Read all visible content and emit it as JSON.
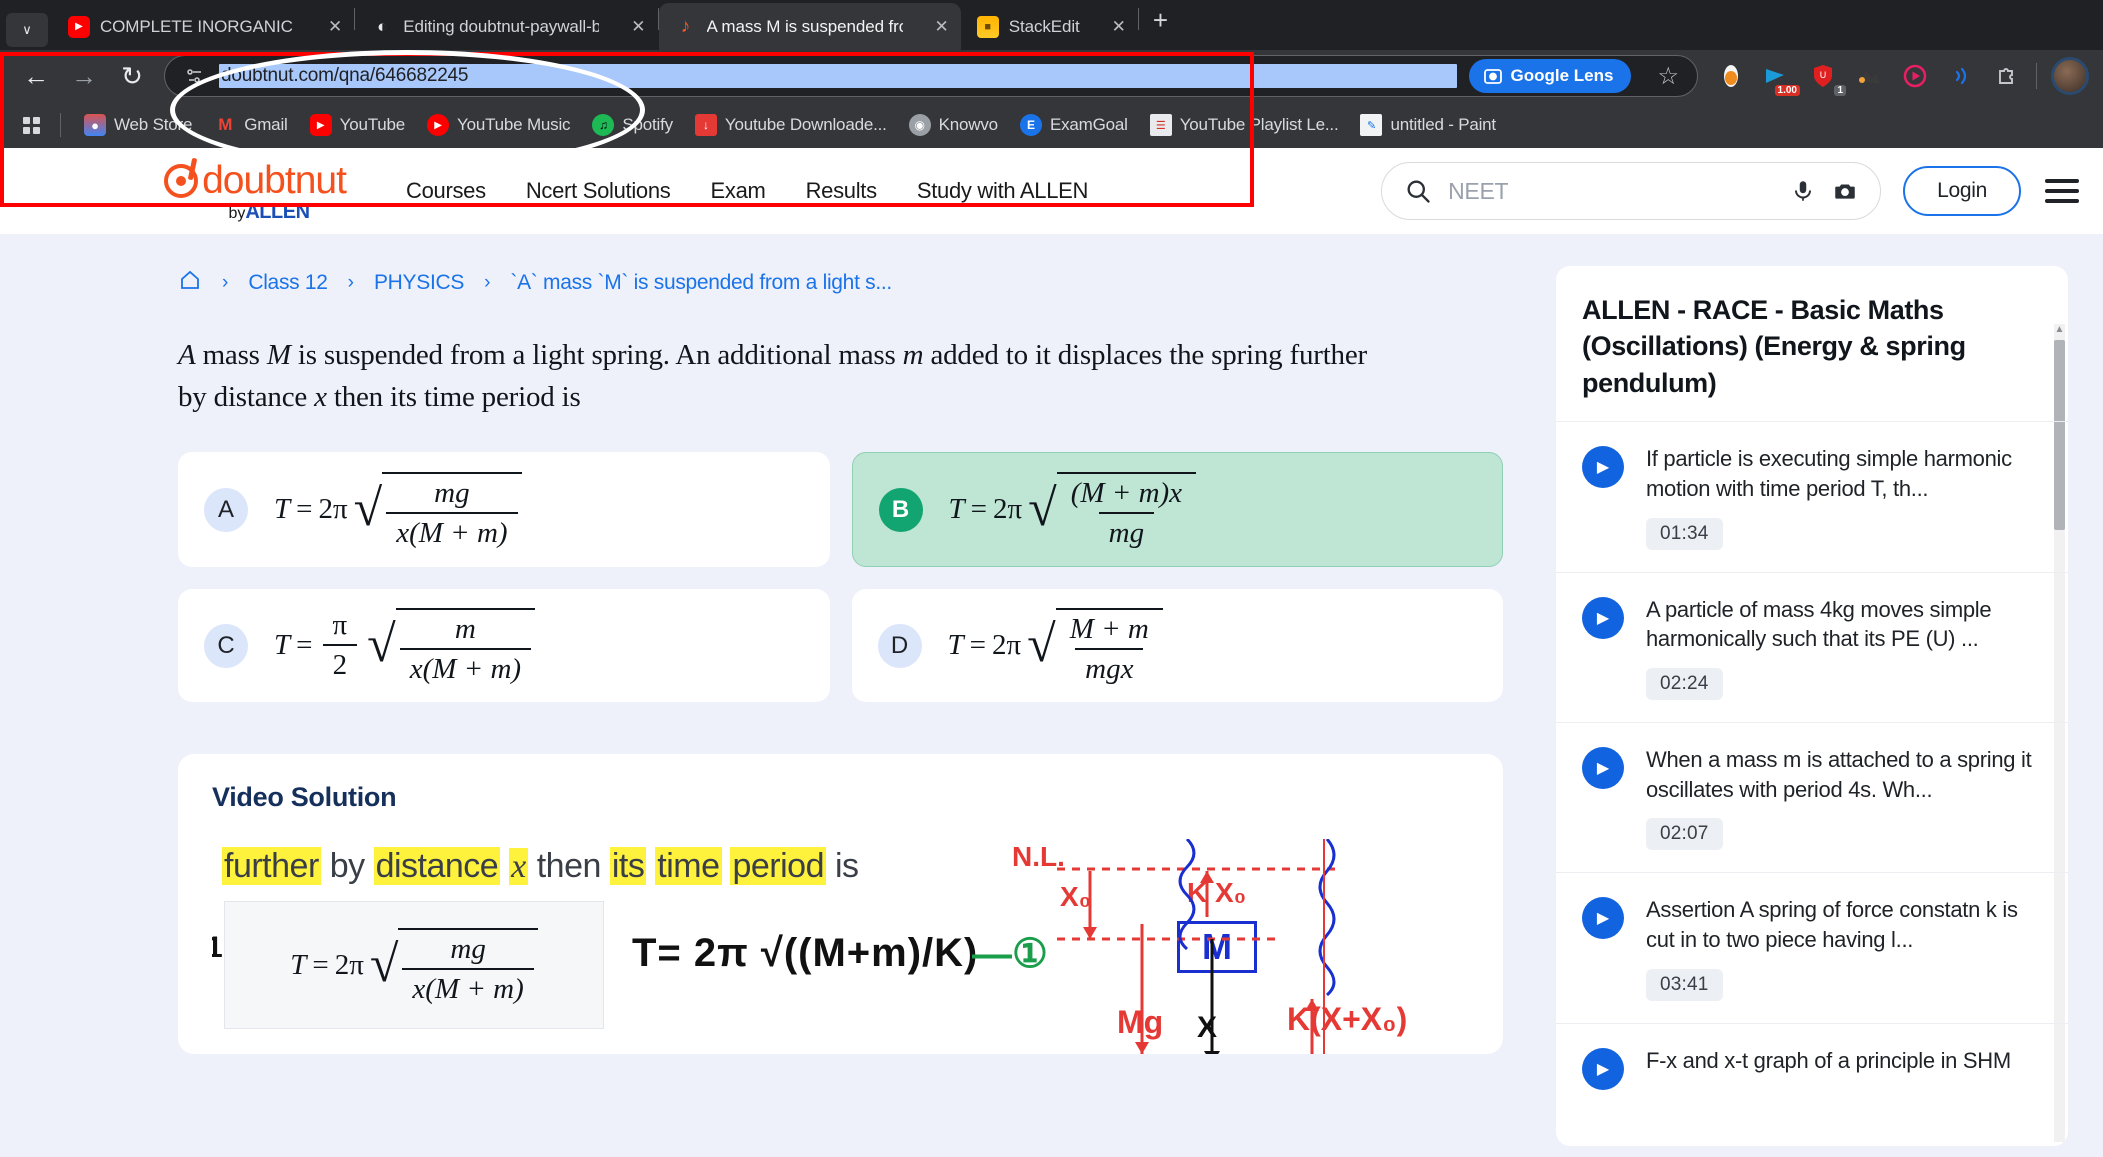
{
  "browser": {
    "tabs": [
      {
        "title": "COMPLETE INORGANIC CHEMI",
        "favicon": "youtube-icon",
        "active": false
      },
      {
        "title": "Editing doubtnut-paywall-bypa",
        "favicon": "edit-icon",
        "active": false
      },
      {
        "title": "A mass M is suspended from a",
        "favicon": "doubtnut-icon",
        "active": true
      },
      {
        "title": "StackEdit",
        "favicon": "stackedit-icon",
        "active": false
      }
    ],
    "tab_close_label": "✕",
    "new_tab_label": "+",
    "tab_search_label": "∨",
    "toolbar": {
      "back_label": "←",
      "forward_label": "→",
      "reload_label": "↻",
      "site_info_label": "site-settings",
      "url": "doubtnut.com/qna/646682245",
      "lens_label": "Google Lens",
      "bookmark_star_label": "☆"
    },
    "extensions": [
      {
        "name": "ublock-origin-icon",
        "badge": ""
      },
      {
        "name": "video-downloader-icon",
        "badge": "1.00"
      },
      {
        "name": "shield-extension-icon",
        "badge": "1"
      },
      {
        "name": "dark-reader-icon",
        "badge": ""
      },
      {
        "name": "media-player-icon",
        "badge": ""
      },
      {
        "name": "cast-audio-icon",
        "badge": ""
      },
      {
        "name": "extensions-puzzle-icon",
        "badge": ""
      }
    ],
    "bookmarks": [
      {
        "label": "Web Store",
        "icon": "webstore-icon"
      },
      {
        "label": "Gmail",
        "icon": "gmail-icon"
      },
      {
        "label": "YouTube",
        "icon": "youtube-icon"
      },
      {
        "label": "YouTube Music",
        "icon": "youtube-music-icon"
      },
      {
        "label": "Spotify",
        "icon": "spotify-icon"
      },
      {
        "label": "Youtube Downloade...",
        "icon": "youtube-downloader-icon"
      },
      {
        "label": "Knowvo",
        "icon": "knowvo-icon"
      },
      {
        "label": "ExamGoal",
        "icon": "examgoal-icon"
      },
      {
        "label": "YouTube Playlist Le...",
        "icon": "playlist-icon"
      },
      {
        "label": "untitled - Paint",
        "icon": "paint-icon"
      }
    ]
  },
  "site": {
    "logo": {
      "name": "doubtnut",
      "sub_prefix": "by",
      "sub_brand": "ALLEN"
    },
    "nav": [
      "Courses",
      "Ncert Solutions",
      "Exam",
      "Results",
      "Study with ALLEN"
    ],
    "search": {
      "placeholder": "NEET",
      "mic_label": "mic-icon",
      "camera_label": "camera-icon"
    },
    "login_label": "Login"
  },
  "breadcrumb": {
    "home_label": "⌂",
    "separator": "›",
    "items": [
      "Class 12",
      "PHYSICS",
      "`A` mass `M` is suspended from a light s..."
    ]
  },
  "question": {
    "line1_a": "A",
    "line1_b": " mass ",
    "line1_c": "M",
    "line1_d": " is suspended from a light spring. An additional mass ",
    "line1_e": "m",
    "line1_f": " added to it displaces the spring further",
    "line2_a": "by distance ",
    "line2_b": "x",
    "line2_c": " then its time period is",
    "full_text": "A mass M is suspended from a light spring. An additional mass m added to it displaces the spring further by distance x then its time period is"
  },
  "options": [
    {
      "badge": "A",
      "correct": false,
      "latex": "T = 2\\pi\\sqrt{\\frac{mg}{x(M+m)}}",
      "lhs": "T",
      "eq": "=",
      "coef": "2π",
      "numerator": "mg",
      "denominator": "x(M + m)",
      "prefix": ""
    },
    {
      "badge": "B",
      "correct": true,
      "latex": "T = 2\\pi\\sqrt{\\frac{(M+m)x}{mg}}",
      "lhs": "T",
      "eq": "=",
      "coef": "2π",
      "numerator": "(M + m)x",
      "denominator": "mg",
      "prefix": ""
    },
    {
      "badge": "C",
      "correct": false,
      "latex": "T = \\frac{\\pi}{2}\\sqrt{\\frac{m}{x(M+m)}}",
      "lhs": "T",
      "eq": "=",
      "coef": "",
      "coef_num": "π",
      "coef_den": "2",
      "numerator": "m",
      "denominator": "x(M + m)",
      "prefix": ""
    },
    {
      "badge": "D",
      "correct": false,
      "latex": "T = 2\\pi\\sqrt{\\frac{M+m}{mgx}}",
      "lhs": "T",
      "eq": "=",
      "coef": "2π",
      "numerator": "M + m",
      "denominator": "mgx",
      "prefix": ""
    }
  ],
  "video_solution": {
    "title": "Video Solution",
    "frame_text": "further by distance x then its time period is",
    "boxed_formula": {
      "lhs": "T",
      "eq": "=",
      "coef": "2π",
      "numerator": "mg",
      "denominator": "x(M + m)"
    },
    "handwritten": {
      "derived_formula": "T= 2π √((M+m)/K)",
      "eq_number": "①",
      "nl_label": "N.L.",
      "x0_label": "X₀",
      "kx0_label": "K X₀",
      "mass_label": "M",
      "mg_label": "Mg",
      "x_label": "X",
      "spring_force_label": "K(X+X₀)",
      "margin_number": "1"
    }
  },
  "sidebar": {
    "title": "ALLEN  -  RACE  -  Basic Maths (Oscillations) (Energy & spring pendulum)",
    "items": [
      {
        "text": "If particle is executing simple harmonic motion with time period T, th...",
        "duration": "01:34"
      },
      {
        "text": "A particle of mass 4kg moves simple harmonically such that its PE (U) ...",
        "duration": "02:24"
      },
      {
        "text": "When a mass m is attached to a spring it oscillates with period 4s. Wh...",
        "duration": "02:07"
      },
      {
        "text": "Assertion A spring of force constatn k is cut in to two piece having l...",
        "duration": "03:41"
      },
      {
        "text": "F-x and x-t graph of a principle in SHM",
        "duration": ""
      }
    ]
  },
  "colors": {
    "accent_blue": "#1a73e8",
    "correct_green": "#13a571",
    "correct_bg": "#bfe5d4",
    "brand_orange": "#f4511e",
    "allen_blue": "#1a4fb5",
    "page_bg": "#eef1fa",
    "annotation_red": "#ff0000",
    "highlight_yellow": "#fff23d"
  }
}
